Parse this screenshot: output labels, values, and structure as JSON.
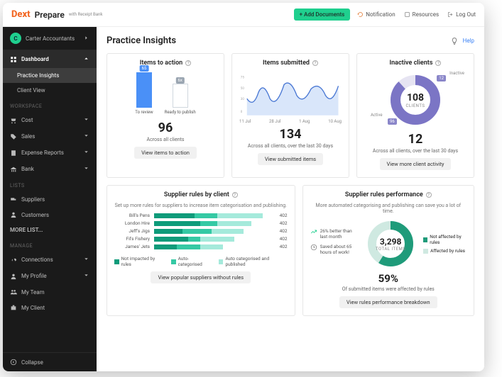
{
  "brand": "Dext",
  "product": "Prepare",
  "product_sub": "with Receipt Bank",
  "topbar": {
    "add_btn": "+ Add Documents",
    "nav": [
      {
        "label": "Notification"
      },
      {
        "label": "Resources"
      },
      {
        "label": "Log Out"
      }
    ]
  },
  "sidebar": {
    "account": {
      "initial": "C",
      "name": "Carter Accountants"
    },
    "dashboard_label": "Dashboard",
    "dashboard_subs": [
      "Practice Insights",
      "Client View"
    ],
    "workspace_label": "WORKSPACE",
    "workspace": [
      "Cost",
      "Sales",
      "Expense Reports",
      "Bank"
    ],
    "lists_label": "LISTS",
    "lists": [
      "Suppliers",
      "Customers"
    ],
    "more_lists": "MORE LIST...",
    "manage_label": "MANAGE",
    "manage": [
      "Connections",
      "My Profile",
      "My Team",
      "My Client"
    ],
    "collapse": "Collapse"
  },
  "page": {
    "title": "Practice Insights",
    "help": "Help",
    "bulb_icon": "bulb-icon"
  },
  "card_actions": {
    "title": "Items to action",
    "bars": [
      {
        "label": "To review",
        "tag": "65"
      },
      {
        "label": "Ready to publish",
        "tag": "6x"
      }
    ],
    "value": "96",
    "caption": "Across all clients",
    "button": "View items to action"
  },
  "card_submitted": {
    "title": "Items submitted",
    "x_labels": [
      "11 Jul",
      "28 Jul",
      "1 Aug",
      "10 Aug"
    ],
    "y_labels": [
      "75",
      "50",
      "30",
      "0"
    ],
    "value": "134",
    "caption": "Across all clients, over the last 30 days",
    "button": "View submitted items"
  },
  "card_inactive": {
    "title": "Inactive clients",
    "center_num": "108",
    "center_sub": "CLIENTS",
    "active_label": "Active",
    "inactive_label": "Inactive",
    "active_tag": "96",
    "inactive_tag": "12",
    "value": "12",
    "caption": "Across all clients, over the last 30 days",
    "button": "View more client activity"
  },
  "card_supplier_rules": {
    "title": "Supplier rules by client",
    "subtitle": "Set up more rules for suppliers to increase item categorisation and publishing.",
    "rows": [
      {
        "name": "Bill's Pens",
        "a": 35,
        "b": 20,
        "c": 40,
        "val": "402"
      },
      {
        "name": "London Hire",
        "a": 40,
        "b": 15,
        "c": 30,
        "val": "402"
      },
      {
        "name": "Jeff's Jigs",
        "a": 25,
        "b": 25,
        "c": 28,
        "val": "402"
      },
      {
        "name": "Fil's Fishery",
        "a": 30,
        "b": 10,
        "c": 30,
        "val": "402"
      },
      {
        "name": "James' Jets",
        "a": 20,
        "b": 20,
        "c": 20,
        "val": "402"
      }
    ],
    "legend": [
      "Not impacted by rules",
      "Auto-categorised",
      "Auto categorised and published"
    ],
    "button": "View popular suppliers without rules"
  },
  "card_perf": {
    "title": "Supplier rules performance",
    "subtitle": "More automated categorising and publishing can save you a lot of time.",
    "stat1": "26% better than last month",
    "stat2": "Saved about 65 hours of work!",
    "center_num": "3,298",
    "center_sub": "TOTAL ITEMS",
    "legend": [
      "Not affected by rules",
      "Affected by rules"
    ],
    "pct": "59%",
    "pct_caption": "Of submitted items were affected by rules",
    "button": "View rules performance breakdown"
  },
  "chart_data": [
    {
      "type": "bar",
      "title": "Items to action",
      "categories": [
        "To review",
        "Ready to publish"
      ],
      "values": [
        65,
        31
      ]
    },
    {
      "type": "line",
      "title": "Items submitted",
      "x": [
        "11 Jul",
        "28 Jul",
        "1 Aug",
        "10 Aug"
      ],
      "ylim": [
        0,
        75
      ],
      "values": [
        40,
        30,
        58,
        35,
        65,
        50,
        40,
        62,
        35,
        60
      ]
    },
    {
      "type": "pie",
      "title": "Inactive clients",
      "series": [
        {
          "name": "Active",
          "value": 96
        },
        {
          "name": "Inactive",
          "value": 12
        }
      ]
    },
    {
      "type": "bar",
      "title": "Supplier rules by client",
      "orientation": "horizontal",
      "categories": [
        "Bill's Pens",
        "London Hire",
        "Jeff's Jigs",
        "Fil's Fishery",
        "James' Jets"
      ],
      "series": [
        {
          "name": "Not impacted by rules",
          "values": [
            140,
            168,
            100,
            126,
            80
          ]
        },
        {
          "name": "Auto-categorised",
          "values": [
            80,
            63,
            100,
            42,
            80
          ]
        },
        {
          "name": "Auto categorised and published",
          "values": [
            182,
            171,
            202,
            234,
            242
          ]
        }
      ]
    },
    {
      "type": "pie",
      "title": "Supplier rules performance",
      "series": [
        {
          "name": "Affected by rules",
          "value": 1946
        },
        {
          "name": "Not affected by rules",
          "value": 1352
        }
      ]
    }
  ]
}
